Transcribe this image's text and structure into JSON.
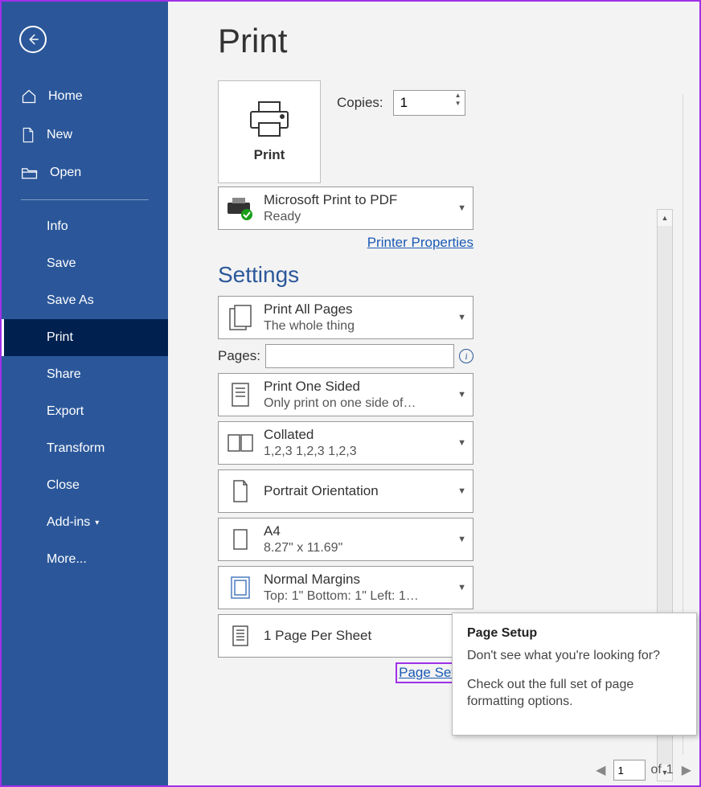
{
  "sidebar": {
    "items_top": [
      {
        "label": "Home"
      },
      {
        "label": "New"
      },
      {
        "label": "Open"
      }
    ],
    "items_bottom": [
      {
        "label": "Info"
      },
      {
        "label": "Save"
      },
      {
        "label": "Save As"
      },
      {
        "label": "Print",
        "selected": true
      },
      {
        "label": "Share"
      },
      {
        "label": "Export"
      },
      {
        "label": "Transform"
      },
      {
        "label": "Close"
      },
      {
        "label": "Add-ins",
        "chevron": true
      },
      {
        "label": "More..."
      }
    ]
  },
  "page": {
    "title": "Print"
  },
  "print_button": {
    "label": "Print"
  },
  "copies": {
    "label": "Copies:",
    "value": "1"
  },
  "printer": {
    "name": "Microsoft Print to PDF",
    "status": "Ready",
    "properties_link": "Printer Properties"
  },
  "settings": {
    "title": "Settings",
    "print_what": {
      "title": "Print All Pages",
      "sub": "The whole thing"
    },
    "pages_label": "Pages:",
    "sided": {
      "title": "Print One Sided",
      "sub": "Only print on one side of…"
    },
    "collate": {
      "title": "Collated",
      "sub": "1,2,3    1,2,3    1,2,3"
    },
    "orientation": {
      "title": "Portrait Orientation"
    },
    "paper": {
      "title": "A4",
      "sub": "8.27\" x 11.69\""
    },
    "margins": {
      "title": "Normal Margins",
      "sub": "Top: 1\" Bottom: 1\" Left: 1…"
    },
    "per_sheet": {
      "title": "1 Page Per Sheet"
    },
    "page_setup_link": "Page Setup"
  },
  "tooltip": {
    "title": "Page Setup",
    "line1": "Don't see what you're looking for?",
    "line2": "Check out the full set of page formatting options."
  },
  "pager": {
    "current": "1",
    "of_label": "of",
    "total": "1"
  }
}
